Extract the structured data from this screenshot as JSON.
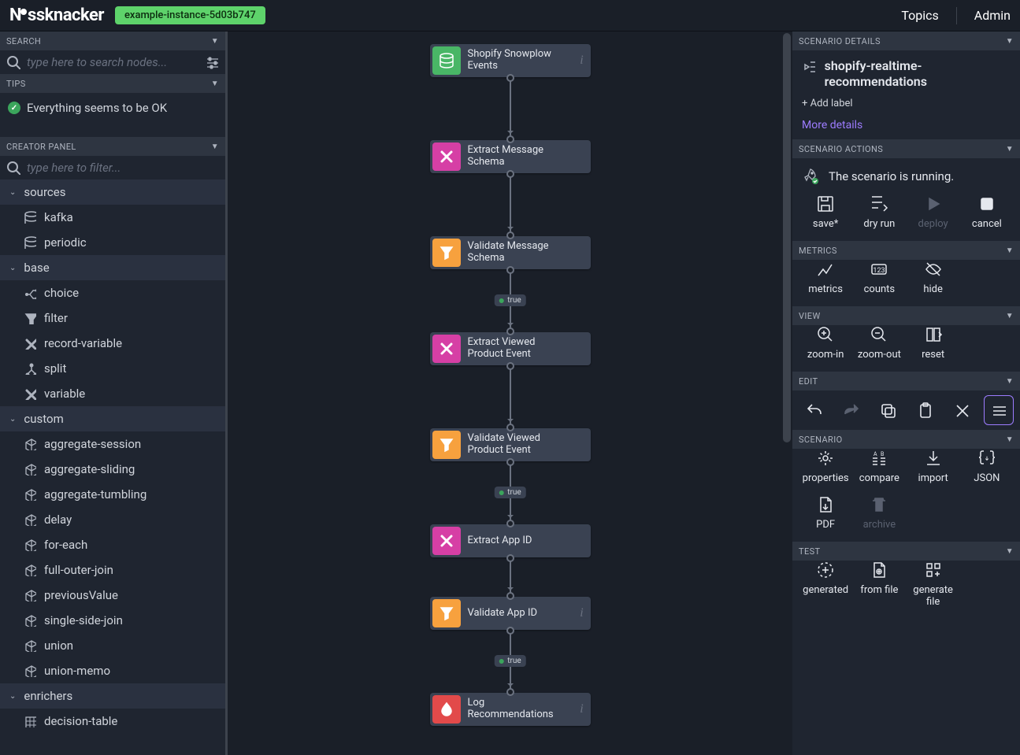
{
  "header": {
    "brand": "Nussknacker",
    "instance": "example-instance-5d03b747",
    "links": {
      "topics": "Topics",
      "admin": "Admin"
    }
  },
  "left": {
    "search": {
      "title": "SEARCH",
      "placeholder": "type here to search nodes..."
    },
    "tips": {
      "title": "TIPS",
      "ok_text": "Everything seems to be OK"
    },
    "creator": {
      "title": "CREATOR PANEL",
      "placeholder": "type here to filter...",
      "groups": [
        {
          "name": "sources",
          "items": [
            {
              "label": "kafka",
              "icon": "db"
            },
            {
              "label": "periodic",
              "icon": "db"
            }
          ]
        },
        {
          "name": "base",
          "items": [
            {
              "label": "choice",
              "icon": "branch"
            },
            {
              "label": "filter",
              "icon": "funnel"
            },
            {
              "label": "record-variable",
              "icon": "x"
            },
            {
              "label": "split",
              "icon": "split"
            },
            {
              "label": "variable",
              "icon": "x"
            }
          ]
        },
        {
          "name": "custom",
          "items": [
            {
              "label": "aggregate-session",
              "icon": "cube"
            },
            {
              "label": "aggregate-sliding",
              "icon": "cube"
            },
            {
              "label": "aggregate-tumbling",
              "icon": "cube"
            },
            {
              "label": "delay",
              "icon": "cube"
            },
            {
              "label": "for-each",
              "icon": "cube"
            },
            {
              "label": "full-outer-join",
              "icon": "cube"
            },
            {
              "label": "previousValue",
              "icon": "cube"
            },
            {
              "label": "single-side-join",
              "icon": "cube"
            },
            {
              "label": "union",
              "icon": "cube"
            },
            {
              "label": "union-memo",
              "icon": "cube"
            }
          ]
        },
        {
          "name": "enrichers",
          "items": [
            {
              "label": "decision-table",
              "icon": "grid"
            }
          ]
        }
      ]
    }
  },
  "canvas": {
    "nodes": [
      {
        "label": "Shopify Snowplow Events",
        "color": "green",
        "icon": "db",
        "info": true
      },
      {
        "label": "Extract Message Schema",
        "color": "pink",
        "icon": "x"
      },
      {
        "label": "Validate Message Schema",
        "color": "orange",
        "icon": "funnel",
        "edge_out_badge": "true"
      },
      {
        "label": "Extract Viewed Product Event",
        "color": "pink",
        "icon": "x"
      },
      {
        "label": "Validate Viewed Product Event",
        "color": "orange",
        "icon": "funnel",
        "edge_out_badge": "true"
      },
      {
        "label": "Extract App ID",
        "color": "pink",
        "icon": "x"
      },
      {
        "label": "Validate App ID",
        "color": "orange",
        "icon": "funnel",
        "info": true,
        "edge_out_badge": "true"
      },
      {
        "label": "Log Recommendations",
        "color": "red",
        "icon": "drop",
        "info": true
      }
    ]
  },
  "right": {
    "details": {
      "title": "SCENARIO DETAILS",
      "name": "shopify-realtime-recommendations",
      "add_label": "+ Add label",
      "more": "More details"
    },
    "actions": {
      "title": "SCENARIO ACTIONS",
      "status": "The scenario is running.",
      "buttons": {
        "save": "save*",
        "dryrun": "dry run",
        "deploy": "deploy",
        "cancel": "cancel"
      }
    },
    "metrics": {
      "title": "METRICS",
      "buttons": {
        "metrics": "metrics",
        "counts": "counts",
        "hide": "hide"
      }
    },
    "view": {
      "title": "VIEW",
      "buttons": {
        "zoomin": "zoom-in",
        "zoomout": "zoom-out",
        "reset": "reset"
      }
    },
    "edit": {
      "title": "EDIT"
    },
    "scenario": {
      "title": "SCENARIO",
      "buttons": {
        "properties": "properties",
        "compare": "compare",
        "import": "import",
        "json": "JSON",
        "pdf": "PDF",
        "archive": "archive"
      }
    },
    "test": {
      "title": "TEST",
      "buttons": {
        "generated": "generated",
        "fromfile": "from file",
        "genfile": "generate file"
      }
    }
  }
}
